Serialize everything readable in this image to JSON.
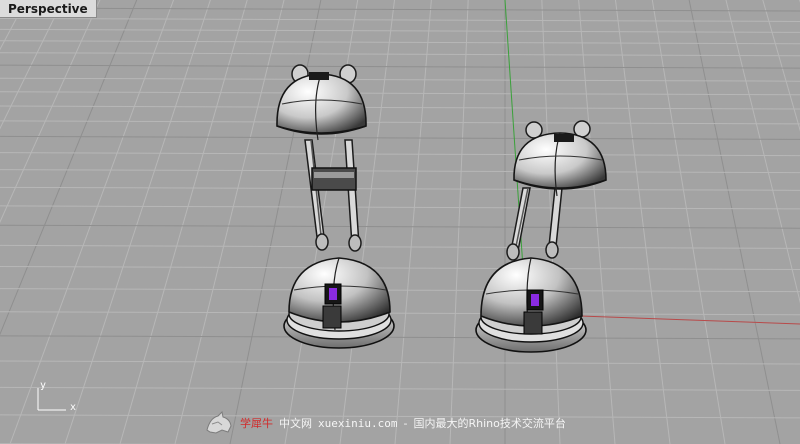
{
  "viewport": {
    "name": "Perspective"
  },
  "axes": {
    "x_label": "x",
    "y_label": "y"
  },
  "watermark": {
    "brand": "学犀牛",
    "site_label": "中文网",
    "url": "xuexiniu.com",
    "separator": "-",
    "slogan": "国内最大的Rhino技术交流平台"
  },
  "colors": {
    "grid_bg": "#a3a3a3",
    "grid_line": "#b7b7b7",
    "grid_major": "#8f8f8f",
    "axis_x": "#b84a4a",
    "axis_y": "#3aa13a",
    "accent_purple": "#8a2be2"
  }
}
